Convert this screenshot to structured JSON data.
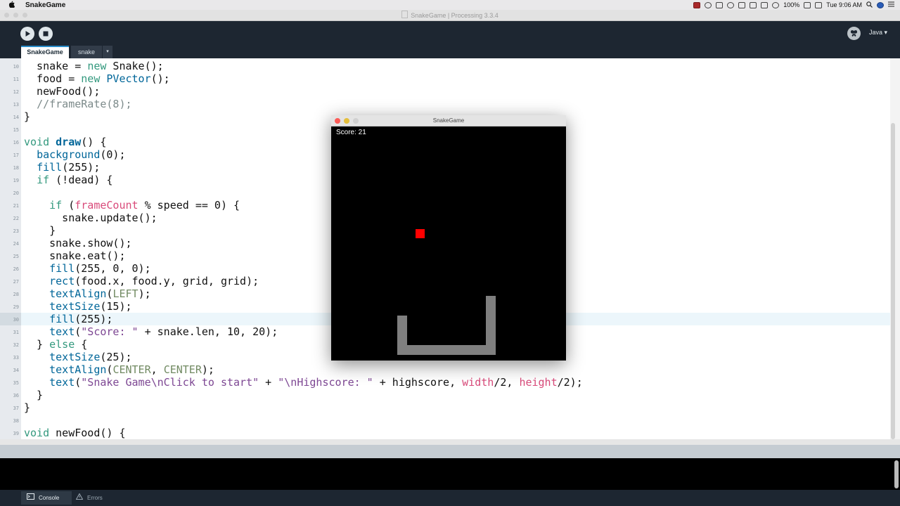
{
  "menubar": {
    "app_name": "SnakeGame",
    "battery": "100%",
    "clock": "Tue 9:06 AM"
  },
  "window": {
    "title": "SnakeGame | Processing 3.3.4"
  },
  "toolbar": {
    "mode": "Java ▾"
  },
  "tabs": [
    {
      "label": "SnakeGame",
      "active": true
    },
    {
      "label": "snake",
      "active": false
    },
    {
      "label": "▾",
      "active": false
    }
  ],
  "editor": {
    "current_line": 30,
    "lines": [
      {
        "n": "10",
        "code": "  snake = new Snake();"
      },
      {
        "n": "11",
        "code": "  food = new PVector();"
      },
      {
        "n": "12",
        "code": "  newFood();"
      },
      {
        "n": "13",
        "code": "  //frameRate(8);"
      },
      {
        "n": "14",
        "code": "}"
      },
      {
        "n": "15",
        "code": ""
      },
      {
        "n": "16",
        "code": "void draw() {"
      },
      {
        "n": "17",
        "code": "  background(0);"
      },
      {
        "n": "18",
        "code": "  fill(255);"
      },
      {
        "n": "19",
        "code": "  if (!dead) {"
      },
      {
        "n": "20",
        "code": ""
      },
      {
        "n": "21",
        "code": "    if (frameCount % speed == 0) {"
      },
      {
        "n": "22",
        "code": "      snake.update();"
      },
      {
        "n": "23",
        "code": "    }"
      },
      {
        "n": "24",
        "code": "    snake.show();"
      },
      {
        "n": "25",
        "code": "    snake.eat();"
      },
      {
        "n": "26",
        "code": "    fill(255, 0, 0);"
      },
      {
        "n": "27",
        "code": "    rect(food.x, food.y, grid, grid);"
      },
      {
        "n": "28",
        "code": "    textAlign(LEFT);"
      },
      {
        "n": "29",
        "code": "    textSize(15);"
      },
      {
        "n": "30",
        "code": "    fill(255);"
      },
      {
        "n": "31",
        "code": "    text(\"Score: \" + snake.len, 10, 20);"
      },
      {
        "n": "32",
        "code": "  } else {"
      },
      {
        "n": "33",
        "code": "    textSize(25);"
      },
      {
        "n": "34",
        "code": "    textAlign(CENTER, CENTER);"
      },
      {
        "n": "35",
        "code": "    text(\"Snake Game\\nClick to start\" + \"\\nHighscore: \" + highscore, width/2, height/2);"
      },
      {
        "n": "36",
        "code": "  }"
      },
      {
        "n": "37",
        "code": "}"
      },
      {
        "n": "38",
        "code": ""
      },
      {
        "n": "39",
        "code": "void newFood() {"
      }
    ]
  },
  "bottom_tabs": {
    "console": "Console",
    "errors": "Errors"
  },
  "sketch_window": {
    "title": "SnakeGame",
    "score_text": "Score: 21",
    "colors": {
      "background": "#000000",
      "food": "#ff0000",
      "snake": "#7f7f7f",
      "text": "#ffffff"
    },
    "grid_size": 14,
    "food_cell": [
      9,
      10
    ],
    "snake_cells": [
      [
        7,
        19
      ],
      [
        7,
        20
      ],
      [
        7,
        21
      ],
      [
        7,
        22
      ],
      [
        8,
        22
      ],
      [
        9,
        22
      ],
      [
        10,
        22
      ],
      [
        11,
        22
      ],
      [
        12,
        22
      ],
      [
        13,
        22
      ],
      [
        14,
        22
      ],
      [
        15,
        22
      ],
      [
        16,
        22
      ],
      [
        16,
        21
      ],
      [
        16,
        20
      ],
      [
        16,
        19
      ],
      [
        16,
        18
      ],
      [
        16,
        17
      ]
    ]
  }
}
